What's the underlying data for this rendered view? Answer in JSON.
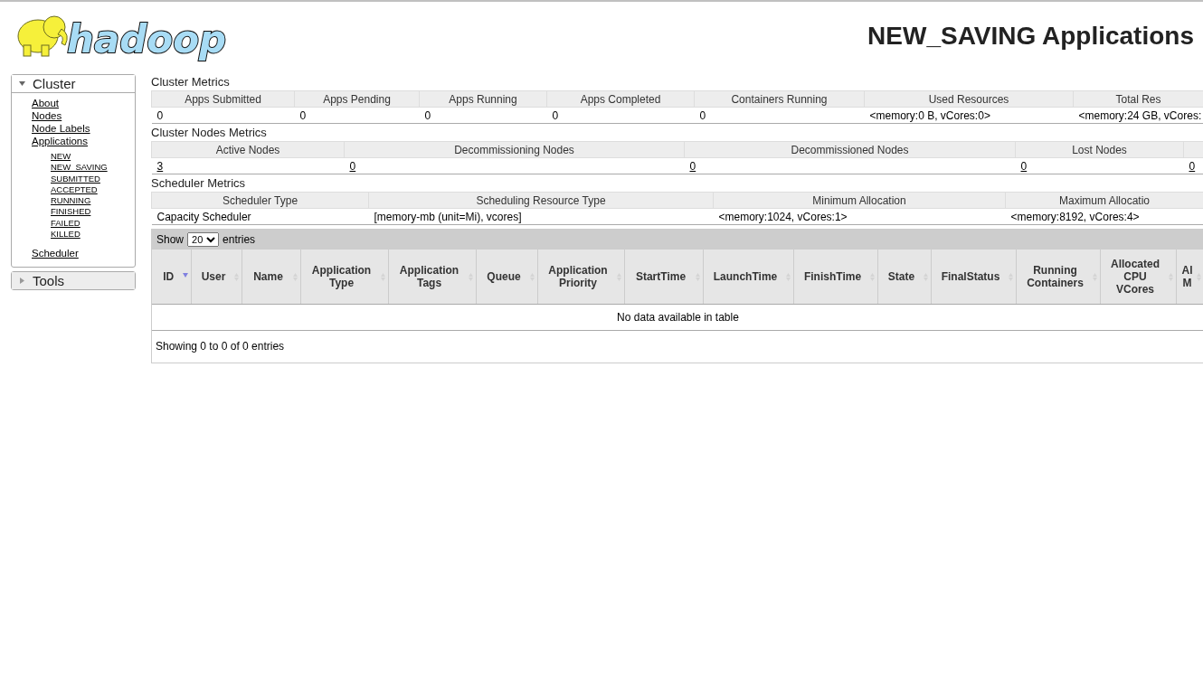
{
  "header": {
    "logo": {
      "text": "hadoop"
    },
    "title": "NEW_SAVING Applications"
  },
  "sidebar": [
    {
      "label": "Cluster",
      "expanded": true,
      "items": [
        {
          "label": "About"
        },
        {
          "label": "Nodes"
        },
        {
          "label": "Node Labels"
        },
        {
          "label": "Applications",
          "children": [
            {
              "label": "NEW"
            },
            {
              "label": "NEW_SAVING"
            },
            {
              "label": "SUBMITTED"
            },
            {
              "label": "ACCEPTED"
            },
            {
              "label": "RUNNING"
            },
            {
              "label": "FINISHED"
            },
            {
              "label": "FAILED"
            },
            {
              "label": "KILLED"
            }
          ]
        },
        {
          "label": "Scheduler"
        }
      ]
    },
    {
      "label": "Tools",
      "expanded": false
    }
  ],
  "metrics": [
    {
      "title": "Cluster Metrics",
      "links": false,
      "columns": [
        "Apps Submitted",
        "Apps Pending",
        "Apps Running",
        "Apps Completed",
        "Containers Running",
        "Used Resources",
        "Total Res"
      ],
      "row": [
        "0",
        "0",
        "0",
        "0",
        "0",
        "<memory:0 B, vCores:0>",
        "<memory:24 GB, vCores:"
      ]
    },
    {
      "title": "Cluster Nodes Metrics",
      "links": true,
      "columns": [
        "Active Nodes",
        "Decommissioning Nodes",
        "Decommissioned Nodes",
        "Lost Nodes",
        ""
      ],
      "row": [
        "3",
        "0",
        "0",
        "0",
        "0"
      ]
    },
    {
      "title": "Scheduler Metrics",
      "links": false,
      "columns": [
        "Scheduler Type",
        "Scheduling Resource Type",
        "Minimum Allocation",
        "Maximum Allocatio"
      ],
      "row": [
        "Capacity Scheduler",
        "[memory-mb (unit=Mi), vcores]",
        "<memory:1024, vCores:1>",
        "<memory:8192, vCores:4>"
      ]
    }
  ],
  "apps_table": {
    "length_control": {
      "before": "Show",
      "value": "20",
      "after": "entries"
    },
    "columns": [
      {
        "label": "ID",
        "sorted": true
      },
      {
        "label": "User",
        "sorted": false
      },
      {
        "label": "Name",
        "sorted": false
      },
      {
        "label": "Application Type",
        "sorted": false
      },
      {
        "label": "Application Tags",
        "sorted": false
      },
      {
        "label": "Queue",
        "sorted": false
      },
      {
        "label": "Application Priority",
        "sorted": false
      },
      {
        "label": "StartTime",
        "sorted": false
      },
      {
        "label": "LaunchTime",
        "sorted": false
      },
      {
        "label": "FinishTime",
        "sorted": false
      },
      {
        "label": "State",
        "sorted": false
      },
      {
        "label": "FinalStatus",
        "sorted": false
      },
      {
        "label": "Running Containers",
        "sorted": false
      },
      {
        "label": "Allocated CPU VCores",
        "sorted": false
      },
      {
        "label": "Al M",
        "sorted": false
      }
    ],
    "empty_message": "No data available in table",
    "info": "Showing 0 to 0 of 0 entries"
  }
}
